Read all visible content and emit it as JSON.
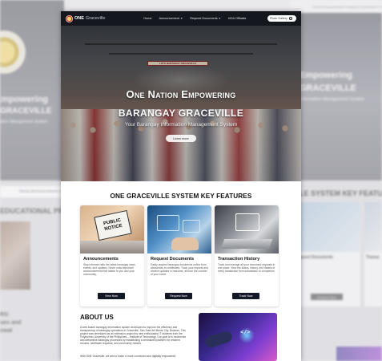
{
  "background": {
    "left_hero_line1": "Empowering",
    "left_hero_line2": "GRACEVILLE",
    "left_hero_line3": "ation Management System",
    "left_nav": "Home   Announcement ▾",
    "left_section": "EDUCATIONAL PR",
    "left_text": "RS:\nues and\newal",
    "right_nav": "Home   Announcement ▾   Request Documents ▾   HOA",
    "right_hero_line1": "Empowering",
    "right_hero_line2": "GRACEVILLE",
    "right_hero_line3": "Information Management System",
    "right_section": "ILLE SYSTEM KEY FEATU",
    "right_card1_title": "quest Documents",
    "right_card2_title": "Transa",
    "right_btn": "Request Now"
  },
  "nav": {
    "logo_one": "ONE",
    "logo_rest": "Graceville",
    "links": [
      {
        "label": "Home",
        "dropdown": false
      },
      {
        "label": "Announcement",
        "dropdown": true
      },
      {
        "label": "Request Documents",
        "dropdown": true
      },
      {
        "label": "HOA Officials",
        "dropdown": false
      }
    ],
    "search_label": "Photo Gallery"
  },
  "hero": {
    "title": "One Nation Empowering",
    "subtitle": "BARANGAY GRACEVILLE",
    "tagline": "Your Barangay Information Management System",
    "cta": "Learn more",
    "banner": "LOTS BARANGAY GRACEVILLE"
  },
  "features": {
    "title": "ONE GRACEVILLE SYSTEM KEY FEATURES",
    "cards": [
      {
        "title": "Announcements",
        "text": "Stay informed with the latest barangay news, events, and updates. Never miss important announcements that matter to you and your community.",
        "button": "View Now",
        "image_label": "PUBLIC NOTICE"
      },
      {
        "title": "Request Documents",
        "text": "Easily request barangay documents online from clearances to certificates. Track your request and receive updates in real-time, all from the comfort of your home.",
        "button": "Request Now"
      },
      {
        "title": "Transaction History",
        "text": "Track and manage all your document requests in one place. View the status, history, and details of every transaction from submission to completion.",
        "button": "Track Now"
      }
    ]
  },
  "about": {
    "title": "ABOUT US",
    "text": "A web-based barangay information system developed to improve the efficiency and transparency of barangay operations in Graceville, San Jose del Monte City, Bulacan. This project was developed as an extension project by nine enthusiastic IT students from the Polytechnic University of the Philippines – Institute of Technology. Our goal is to modernize and streamline barangay processes by establishing a centralized platform for resident records, certificate requests, and community notices.",
    "text2": "With ONE Graceville, we aim to foster a more connected and digitally empowered"
  },
  "colors": {
    "nav_bg": "#15171f",
    "button_bg": "#121826",
    "accent": "#ffffff"
  }
}
